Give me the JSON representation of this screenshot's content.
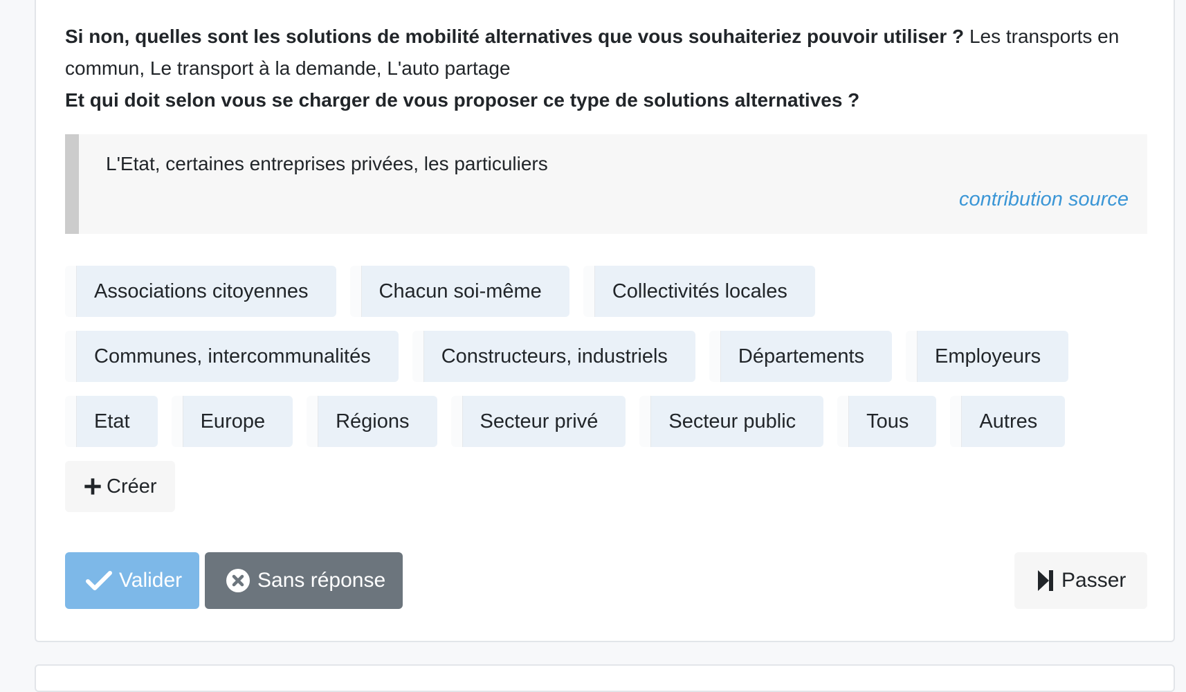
{
  "question": {
    "q1_bold": "Si non, quelles sont les solutions de mobilité alternatives que vous souhaiteriez pouvoir utiliser ?",
    "q1_answer": "Les transports en commun, Le transport à la demande, L'auto partage",
    "q2_bold": "Et qui doit selon vous se charger de vous proposer ce type de solutions alternatives ?"
  },
  "quote": {
    "text": "L'Etat, certaines entreprises privées, les particuliers",
    "source_link": "contribution source",
    "link_color": "#3b96d6"
  },
  "tags": [
    [
      "Associations citoyennes",
      "Chacun soi-même",
      "Collectivités locales"
    ],
    [
      "Communes, intercommunalités",
      "Constructeurs, industriels",
      "Départements",
      "Employeurs"
    ],
    [
      "Etat",
      "Europe",
      "Régions",
      "Secteur privé",
      "Secteur public",
      "Tous",
      "Autres"
    ]
  ],
  "create_button": {
    "label": "Créer",
    "icon": "plus-icon"
  },
  "actions": {
    "validate": {
      "label": "Valider",
      "icon": "check-icon",
      "color": "#7db8e8"
    },
    "no_answer": {
      "label": "Sans réponse",
      "icon": "circle-x-icon",
      "color": "#6c757d"
    },
    "skip": {
      "label": "Passer",
      "icon": "skip-forward-icon"
    }
  }
}
